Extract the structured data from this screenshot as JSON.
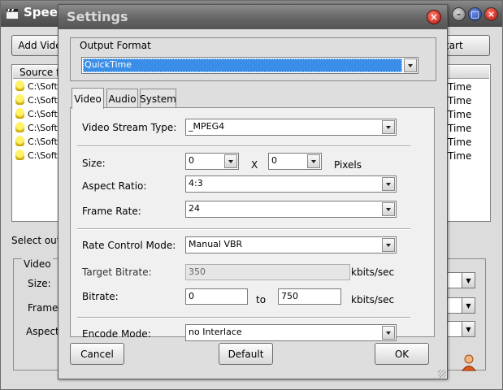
{
  "background_window": {
    "title": "Speed",
    "add_button": "Add Vide",
    "start_button": "tart",
    "list_header": "Source fi",
    "rows": [
      "C:\\Soft",
      "C:\\Soft",
      "C:\\Soft",
      "C:\\Soft",
      "C:\\Soft",
      "C:\\Soft"
    ],
    "row_right": [
      "Time",
      "Time",
      "Time",
      "Time",
      "Time",
      "Time"
    ],
    "select_label": "Select outp",
    "group_label": "Video",
    "size_label": "Size:",
    "frame_label": "Frame",
    "aspect_label": "Aspect"
  },
  "dialog": {
    "title": "Settings",
    "close": "×",
    "output_format": {
      "label": "Output Format",
      "value": "QuickTime"
    },
    "tabs": [
      {
        "label": "Video"
      },
      {
        "label": "Audio"
      },
      {
        "label": "System"
      }
    ],
    "video": {
      "stream_type_label": "Video Stream Type:",
      "stream_type_value": "_MPEG4",
      "size_label": "Size:",
      "size_w": "0",
      "size_x": "X",
      "size_h": "0",
      "pixels_label": "Pixels",
      "aspect_label": "Aspect Ratio:",
      "aspect_value": "4:3",
      "frame_rate_label": "Frame Rate:",
      "frame_rate_value": "24",
      "rate_mode_label": "Rate Control Mode:",
      "rate_mode_value": "Manual VBR",
      "target_bitrate_label": "Target Bitrate:",
      "target_bitrate_value": "350",
      "kbits1": "kbits/sec",
      "bitrate_label": "Bitrate:",
      "bitrate_min": "0",
      "to_label": "to",
      "bitrate_max": "750",
      "kbits2": "kbits/sec",
      "encode_label": "Encode Mode:",
      "encode_value": "no Interlace"
    },
    "buttons": {
      "cancel": "Cancel",
      "default": "Default",
      "ok": "OK"
    }
  },
  "colors": {
    "selection": "#3a8ee8",
    "title_bar": "#656565",
    "close_red": "#b4170c"
  }
}
